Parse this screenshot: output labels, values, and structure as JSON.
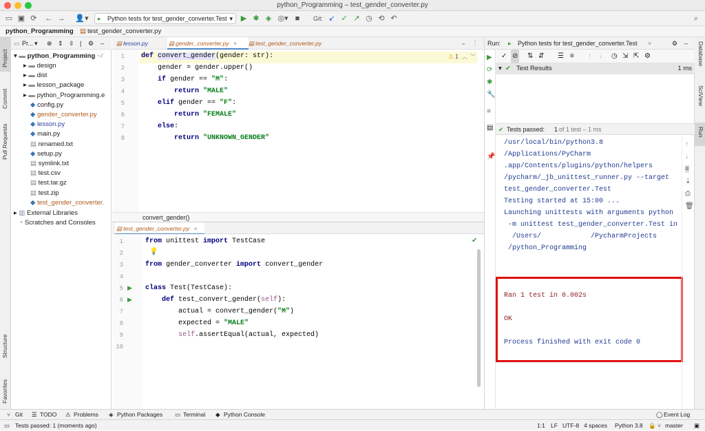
{
  "window": {
    "title": "python_Programming – test_gender_converter.py"
  },
  "toolbar": {
    "run_config": "Python tests for test_gender_converter.Test",
    "git_label": "Git:"
  },
  "breadcrumb": {
    "project": "python_Programming",
    "file": "test_gender_converter.py"
  },
  "left_strip": {
    "project": "Project",
    "commit": "Commit",
    "pull_requests": "Pull Requests",
    "structure": "Structure",
    "favorites": "Favorites"
  },
  "right_strip": {
    "database": "Database",
    "sciview": "SciView",
    "run": "Run"
  },
  "project_panel": {
    "header": "Pr...",
    "root": "python_Programming",
    "root_suffix": "~/",
    "items": [
      {
        "label": "design",
        "type": "folder"
      },
      {
        "label": "dist",
        "type": "folder"
      },
      {
        "label": "lesson_package",
        "type": "folder"
      },
      {
        "label": "python_Programming.e",
        "type": "folder"
      },
      {
        "label": "config.py",
        "type": "py"
      },
      {
        "label": "gender_converter.py",
        "type": "py-mod"
      },
      {
        "label": "lesson.py",
        "type": "py-blue"
      },
      {
        "label": "main.py",
        "type": "py"
      },
      {
        "label": "renamed.txt",
        "type": "txt"
      },
      {
        "label": "setup.py",
        "type": "py"
      },
      {
        "label": "symlink.txt",
        "type": "txt"
      },
      {
        "label": "test.csv",
        "type": "txt"
      },
      {
        "label": "test.tar.gz",
        "type": "txt"
      },
      {
        "label": "test.zip",
        "type": "txt"
      },
      {
        "label": "test_gender_converter.",
        "type": "py-mod"
      }
    ],
    "external": "External Libraries",
    "scratches": "Scratches and Consoles"
  },
  "editor_top": {
    "tabs": [
      "lesson.py",
      "gender_converter.py",
      "test_gender_converter.py"
    ],
    "warning": "1",
    "footer": "convert_gender()",
    "lines": [
      "1",
      "2",
      "3",
      "4",
      "5",
      "6",
      "7",
      "8"
    ]
  },
  "editor_bottom": {
    "tab": "test_gender_converter.py",
    "lines": [
      "1",
      "2",
      "3",
      "4",
      "5",
      "6",
      "7",
      "8",
      "9",
      "10"
    ]
  },
  "run_panel": {
    "label": "Run:",
    "config": "Python tests for test_gender_converter.Test",
    "test_results": "Test Results",
    "test_time": "1 ms",
    "passed": "Tests passed:",
    "passed_count": "1",
    "passed_detail": "of 1 test – 1 ms",
    "console": [
      "/usr/local/bin/python3.8",
      "/Applications/PyCharm",
      ".app/Contents/plugins/python/helpers",
      "/pycharm/_jb_unittest_runner.py --target",
      "test_gender_converter.Test",
      "Testing started at 15:00 ...",
      "Launching unittests with arguments python",
      " -m unittest test_gender_converter.Test in",
      "  /Users/            /PycharmProjects",
      " /python_Programming"
    ],
    "result_lines": [
      "Ran 1 test in 0.002s",
      "OK",
      "Process finished with exit code 0"
    ]
  },
  "bottom_tools": [
    "Git",
    "TODO",
    "Problems",
    "Python Packages",
    "Terminal",
    "Python Console"
  ],
  "event_log": "Event Log",
  "status": {
    "message": "Tests passed: 1 (moments ago)",
    "position": "1:1",
    "line_sep": "LF",
    "encoding": "UTF-8",
    "indent": "4 spaces",
    "interpreter": "Python 3.8",
    "branch": "master"
  },
  "colors": {
    "highlight_box": "#e01010",
    "pass_green": "#3d9a3d",
    "console_blue": "#1f3b8f",
    "result_red": "#8b1c1c"
  }
}
